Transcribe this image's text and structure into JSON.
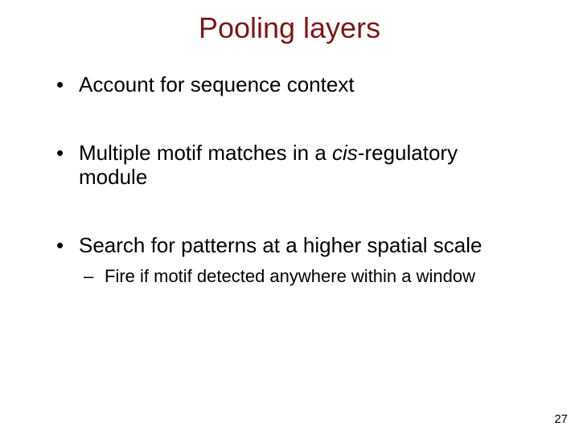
{
  "title": "Pooling layers",
  "bullets": {
    "b1": "Account for sequence context",
    "b2_pre": "Multiple motif matches in a ",
    "b2_em": "cis",
    "b2_post": "-regulatory module",
    "b3": "Search for patterns at a higher spatial scale",
    "b3_sub1": "Fire if motif detected anywhere within a window"
  },
  "page_number": "27"
}
